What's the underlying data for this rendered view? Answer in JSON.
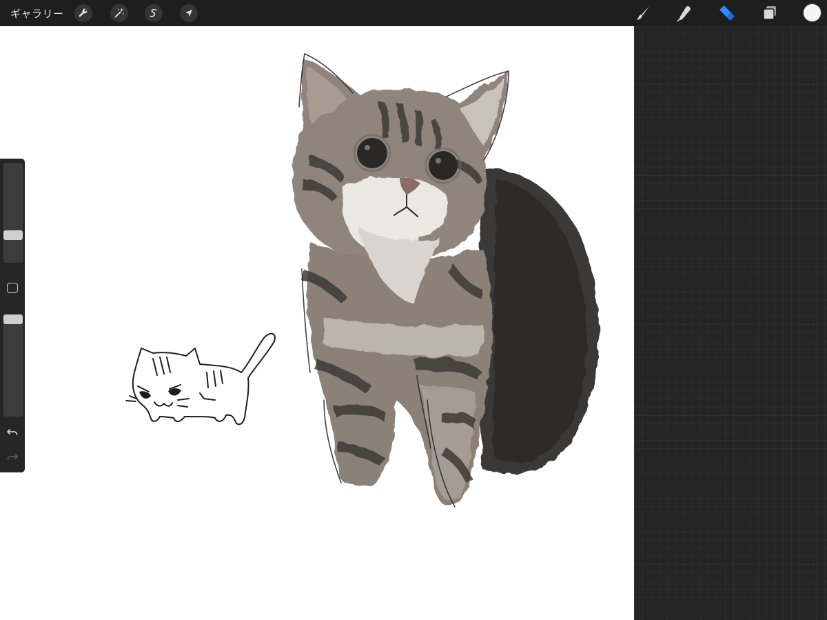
{
  "topbar": {
    "gallery_label": "ギャラリー",
    "left_tools": [
      {
        "name": "actions",
        "icon": "wrench-icon"
      },
      {
        "name": "adjustments",
        "icon": "magic-wand-icon"
      },
      {
        "name": "selection",
        "icon": "selection-s-icon"
      },
      {
        "name": "transform",
        "icon": "arrow-cursor-icon"
      }
    ],
    "right_tools": [
      {
        "name": "brush",
        "icon": "brush-icon",
        "active": false
      },
      {
        "name": "smudge",
        "icon": "smudge-finger-icon",
        "active": false
      },
      {
        "name": "eraser",
        "icon": "eraser-icon",
        "active": true
      },
      {
        "name": "layers",
        "icon": "layers-icon",
        "active": false
      }
    ],
    "current_color": "#f5f5f5",
    "active_color": "#2f8cff"
  },
  "sidebar": {
    "brush_size": 0.25,
    "brush_opacity": 1.0,
    "modify_icon": "square-icon",
    "undo_icon": "undo-icon",
    "redo_icon": "redo-icon"
  },
  "canvas": {
    "background": "#ffffff",
    "drawings": [
      "painted-tabby-cat",
      "line-drawing-small-cat"
    ]
  }
}
